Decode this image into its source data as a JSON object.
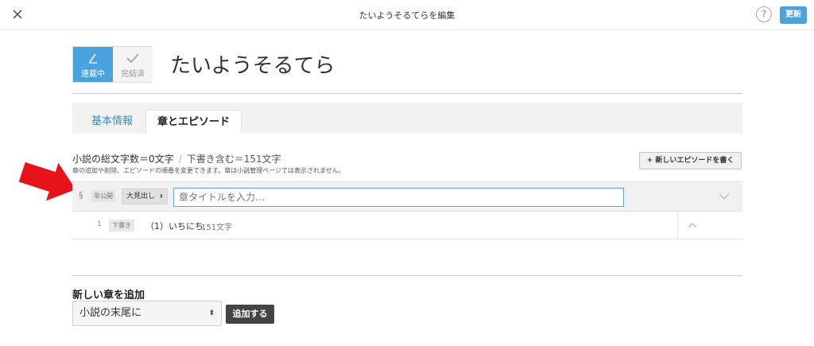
{
  "header": {
    "title": "たいようそるてらを編集",
    "help_label": "?",
    "update_label": "更新"
  },
  "status": {
    "ongoing_label": "連載中",
    "completed_label": "完結済"
  },
  "novel": {
    "title": "たいようそるてら"
  },
  "tabs": [
    {
      "label": "基本情報"
    },
    {
      "label": "章とエピソード"
    }
  ],
  "stats": {
    "total": "小説の総文字数＝0文字",
    "separator": "/",
    "with_drafts": "下書き含む＝151文字",
    "hint": "章の追加や削除、エピソードの順番を変更できます。章は小説管理ページでは表示されません。"
  },
  "new_episode_label": "+ 新しいエピソードを書く",
  "chapter": {
    "mark": "§",
    "visibility": "非公開",
    "heading_level": "大見出し",
    "select_arrows": "⬍",
    "title_placeholder": "章タイトルを入力…"
  },
  "episodes": [
    {
      "number": "1",
      "status": "下書き",
      "title": "（1）いちにち",
      "char_count": "151文字"
    }
  ],
  "add_chapter": {
    "heading": "新しい章を追加",
    "position_selected": "小説の末尾に",
    "select_arrows": "⬍",
    "add_label": "追加する"
  },
  "colors": {
    "accent": "#4aa3df",
    "arrow": "#e8121b",
    "dark_button": "#444444"
  }
}
